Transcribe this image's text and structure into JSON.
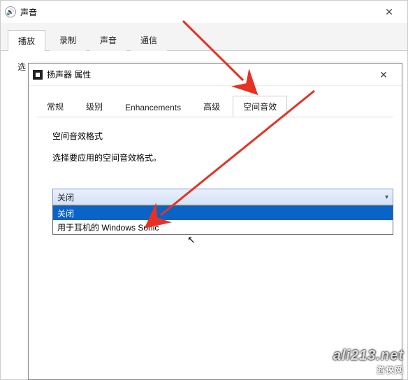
{
  "parent_dialog": {
    "title": "声音",
    "tabs": [
      "播放",
      "录制",
      "声音",
      "通信"
    ],
    "active_tab_index": 0,
    "body_label": "选"
  },
  "child_dialog": {
    "title": "扬声器 属性",
    "tabs": [
      "常规",
      "级别",
      "Enhancements",
      "高级",
      "空间音效"
    ],
    "active_tab_index": 4,
    "section_label": "空间音效格式",
    "section_desc": "选择要应用的空间音效格式。",
    "combo": {
      "value": "关闭",
      "options": [
        "关闭",
        "用于耳机的 Windows Sonic"
      ],
      "highlighted_index": 0
    }
  },
  "watermark": {
    "main": "ali213.net",
    "sub": "游侠网"
  },
  "annotation": {
    "color": "#e73223"
  }
}
